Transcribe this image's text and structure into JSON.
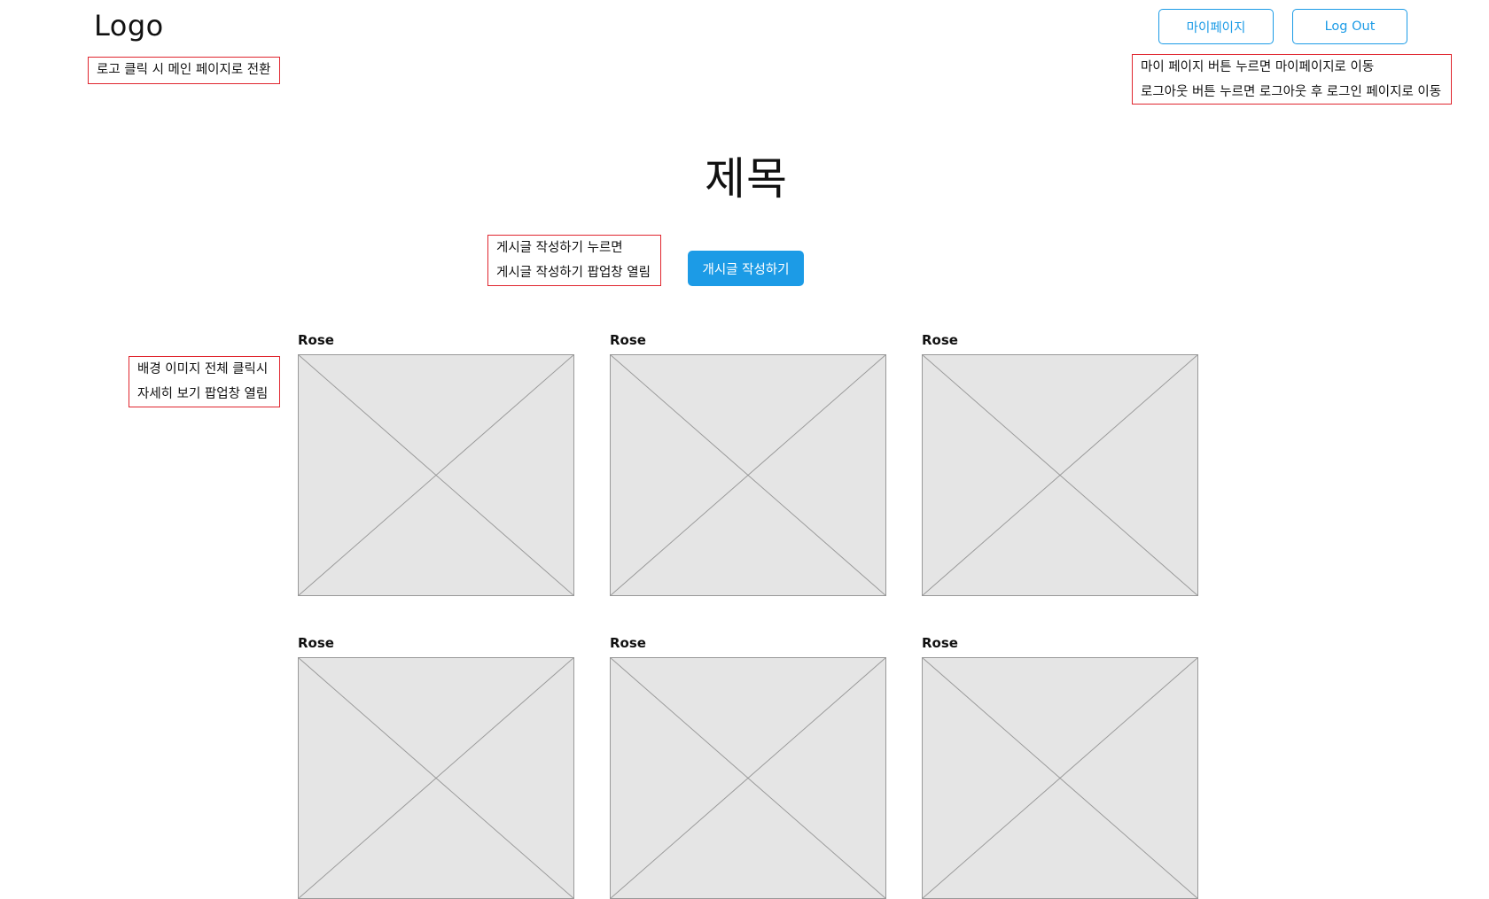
{
  "header": {
    "logo": "Logo",
    "mypage_label": "마이페이지",
    "logout_label": "Log Out"
  },
  "notes": {
    "logo": [
      "로고 클릭 시 메인 페이지로 전환"
    ],
    "header_buttons": [
      "마이 페이지 버튼  누르면 마이페이지로 이동",
      "로그아웃 버튼 누르면 로그아웃 후 로그인 페이지로 이동"
    ],
    "write": [
      "게시글 작성하기 누르면",
      "게시글 작성하기 팝업창 열림"
    ],
    "card": [
      "배경 이미지 전체 클릭시",
      "자세히 보기 팝업창 열림"
    ]
  },
  "main": {
    "title": "제목",
    "write_label": "개시글 작성하기",
    "cards": [
      {
        "title": "Rose"
      },
      {
        "title": "Rose"
      },
      {
        "title": "Rose"
      },
      {
        "title": "Rose"
      },
      {
        "title": "Rose"
      },
      {
        "title": "Rose"
      }
    ]
  },
  "colors": {
    "accent": "#1c9be6",
    "note_border": "#e0262f",
    "placeholder_fill": "#e5e5e5",
    "placeholder_stroke": "#999999"
  }
}
